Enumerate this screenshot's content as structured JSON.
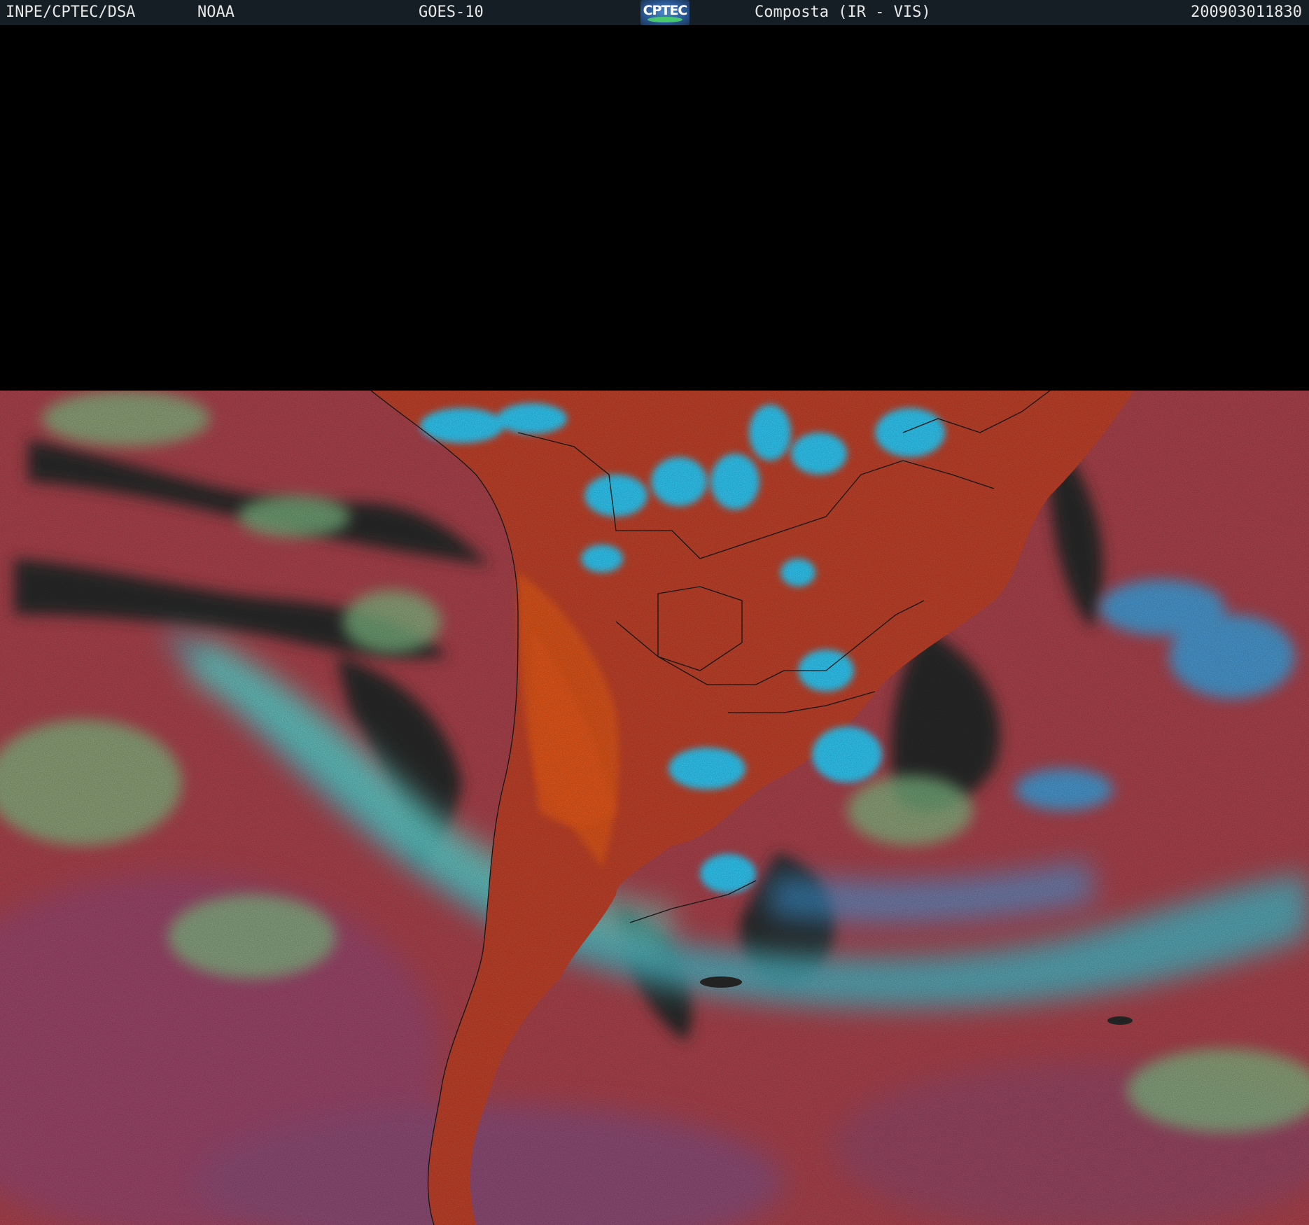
{
  "header": {
    "institution": "INPE/CPTEC/DSA",
    "agency": "NOAA",
    "satellite": "GOES-10",
    "logo_text": "CPTEC",
    "product": "Composta (IR - VIS)",
    "datetime": "200903011830"
  },
  "colors": {
    "header_background": "#141e24",
    "space_background": "#000000",
    "ocean_red": "#b2454f",
    "land_orange": "#e24f1f",
    "cloud_cyan": "#2fd3ff",
    "cloud_green": "#7fd48a",
    "clear_sky_dark": "#2a2a2a",
    "border_lines": "#1a1a1a"
  }
}
